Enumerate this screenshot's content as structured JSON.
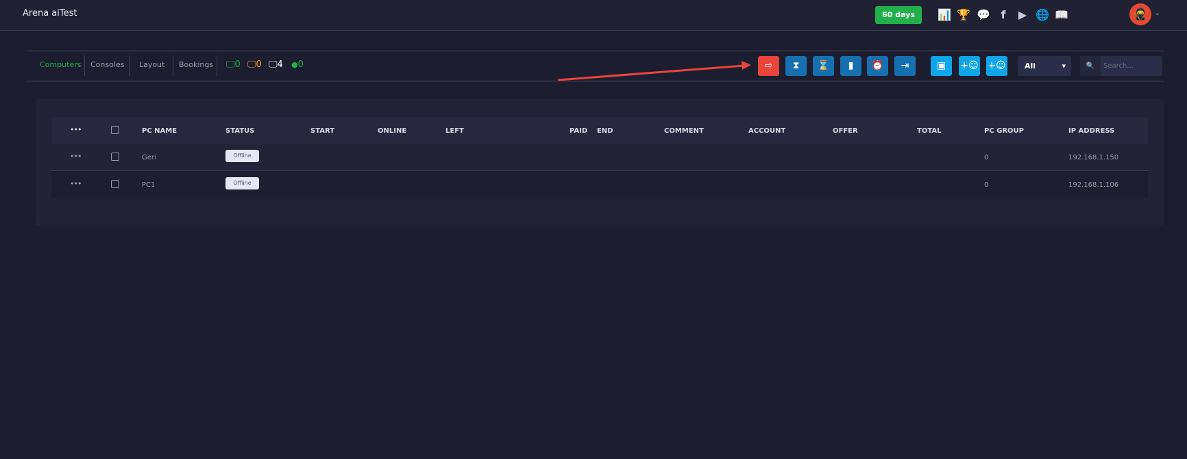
{
  "header": {
    "title": "Arena aiTest",
    "subscription": "60 days",
    "icons": [
      "leaderboard-icon",
      "trophy-icon",
      "discord-icon",
      "facebook-icon",
      "youtube-icon",
      "globe-icon",
      "book-icon"
    ],
    "avatar": "ninja-avatar"
  },
  "tabs": [
    {
      "label": "Computers",
      "active": true
    },
    {
      "label": "Consoles"
    },
    {
      "label": "Layout"
    },
    {
      "label": "Bookings"
    }
  ],
  "counters": [
    {
      "icon": "monitor-icon",
      "value": "0",
      "color": "#22b04b"
    },
    {
      "icon": "monitor-icon",
      "value": "0",
      "color": "#f5a623"
    },
    {
      "icon": "monitor-icon",
      "value": "4",
      "color": "#ffffff"
    },
    {
      "icon": "user-icon",
      "value": "0",
      "color": "#22b04b"
    }
  ],
  "toolbar": {
    "filter": "All",
    "search_placeholder": "Search..."
  },
  "table": {
    "columns": [
      "PC NAME",
      "STATUS",
      "START",
      "ONLINE",
      "LEFT",
      "PAID",
      "END",
      "COMMENT",
      "ACCOUNT",
      "OFFER",
      "TOTAL",
      "PC GROUP",
      "IP ADDRESS"
    ],
    "rows": [
      {
        "name": "Geri",
        "status": "Offline",
        "group": "0",
        "ip": "192.168.1.150"
      },
      {
        "name": "PC1",
        "status": "Offline",
        "group": "0",
        "ip": "192.168.1.106"
      }
    ]
  }
}
